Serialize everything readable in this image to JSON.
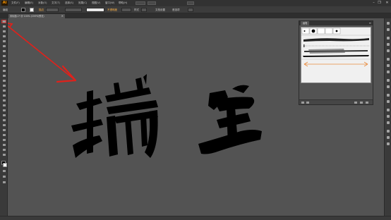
{
  "app": {
    "logo_text": "Ai"
  },
  "menubar": {
    "items": [
      "文件(F)",
      "编辑(E)",
      "对象(O)",
      "文字(T)",
      "选择(S)",
      "效果(C)",
      "视图(V)",
      "窗口(W)",
      "帮助(H)"
    ],
    "window_controls": {
      "minimize": "–",
      "restore": "❐",
      "close": "✕"
    }
  },
  "control_bar": {
    "labels": [
      "编组",
      "描边",
      "不透明度",
      "样式",
      "文档设置",
      "首选项"
    ]
  },
  "document_tab": {
    "title": "未标题-1* @ 100% (CMYK/预览)",
    "close": "×"
  },
  "brushes_panel": {
    "tab_label": "画笔",
    "menu_icon": "≡"
  },
  "colors": {
    "accent": "#ff9a00",
    "selection_border": "#c23030",
    "arrow": "#e0211b",
    "canvas": "#535353",
    "ink": "#000000"
  }
}
